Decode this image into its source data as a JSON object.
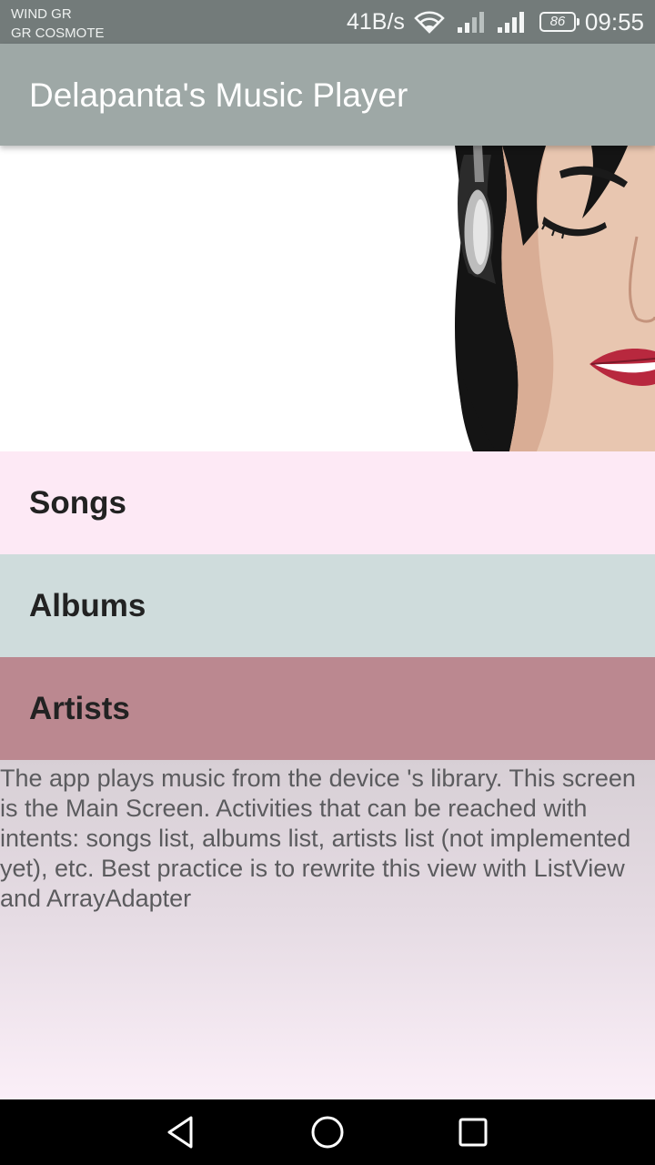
{
  "status_bar": {
    "carrier_1": "WIND GR",
    "carrier_2": "GR COSMOTE",
    "net_speed": "41B/s",
    "battery_level": "86",
    "time": "09:55",
    "icons": [
      "wifi-icon",
      "signal-1-icon",
      "signal-2-icon",
      "battery-icon"
    ]
  },
  "app_bar": {
    "title": "Delapanta's Music Player"
  },
  "menu": {
    "items": [
      {
        "label": "Songs",
        "color": "#fde9f5"
      },
      {
        "label": "Albums",
        "color": "#cfdcdc"
      },
      {
        "label": "Artists",
        "color": "#bb8890"
      }
    ]
  },
  "description": "The app plays music from the device 's library. This screen is the Main Screen. Activities that can be reached with intents: songs list, albums list, artists list (not implemented yet), etc. Best practice is to rewrite this view with ListView and ArrayAdapter",
  "nav_bar": {
    "icons": [
      "back-icon",
      "home-icon",
      "recents-icon"
    ]
  },
  "colors": {
    "status_bar": "#737b7a",
    "app_bar": "#9ea8a6",
    "nav_bar": "#000000"
  }
}
